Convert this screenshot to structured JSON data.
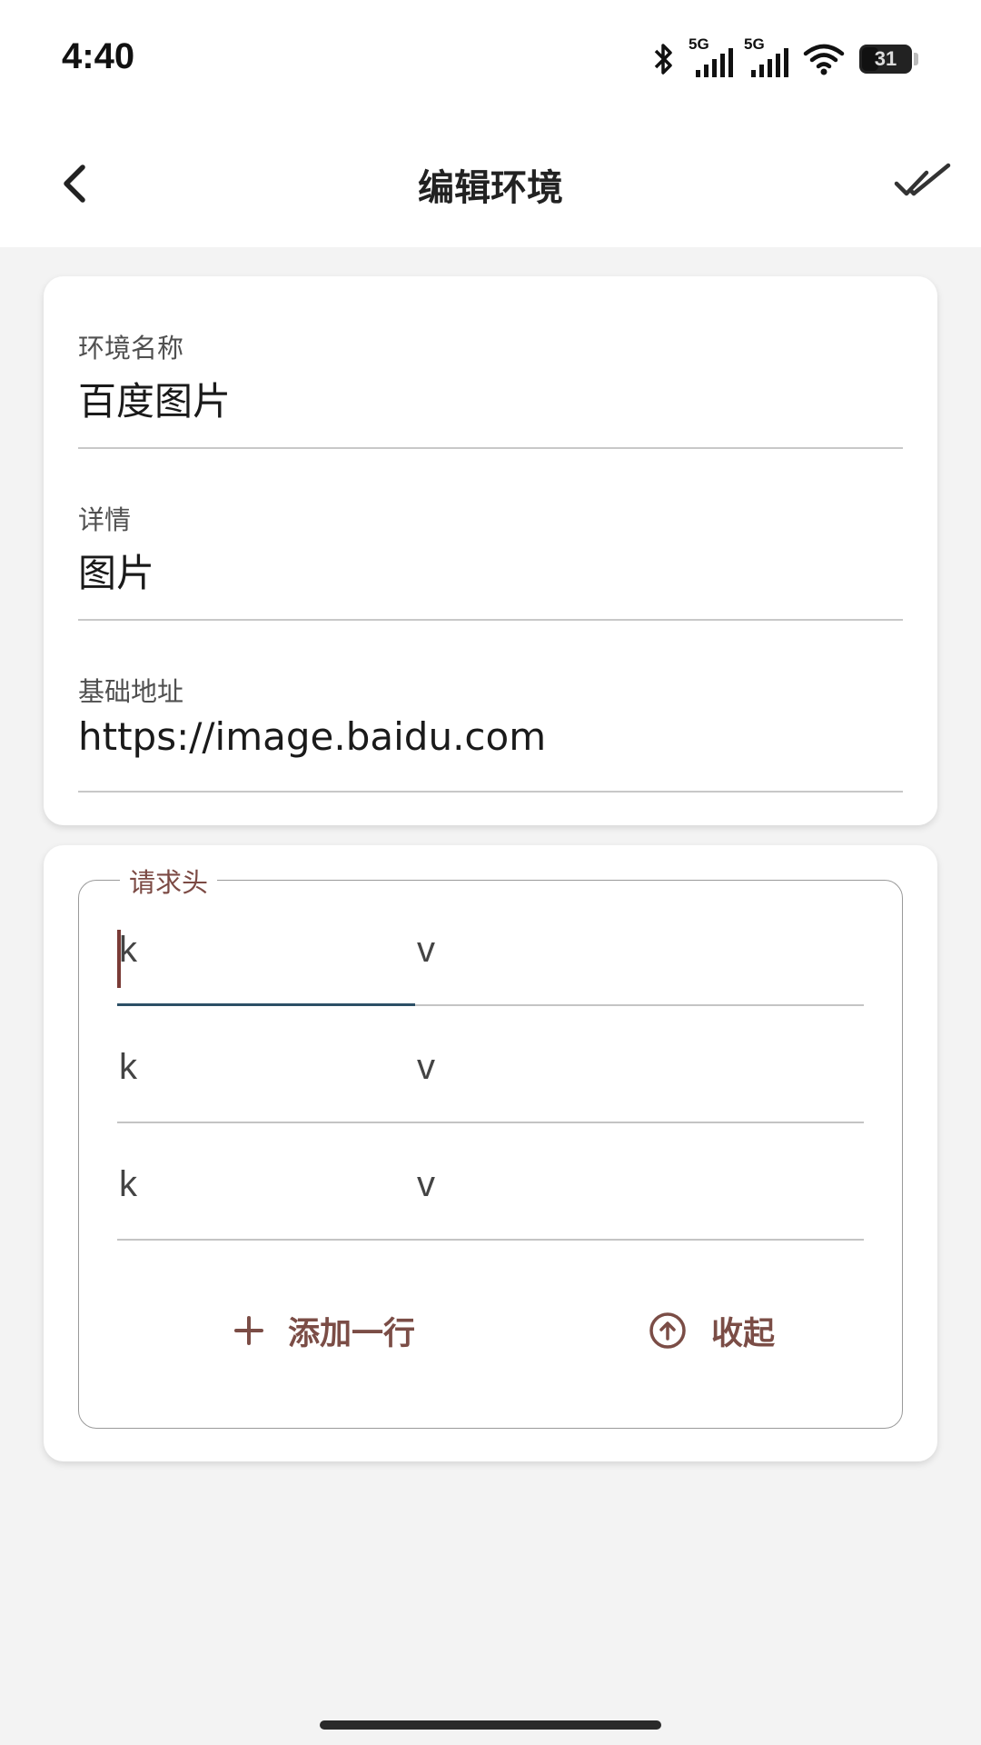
{
  "status_bar": {
    "time": "4:40",
    "network_1": "5G",
    "network_2": "5G",
    "battery_level": "31",
    "icons": [
      "bluetooth-icon",
      "signal-icon",
      "signal-icon",
      "wifi-icon",
      "battery-icon"
    ]
  },
  "app_bar": {
    "title": "编辑环境",
    "back_icon": "chevron-left-icon",
    "confirm_icon": "double-check-icon"
  },
  "environment": {
    "name_label": "环境名称",
    "name_value": "百度图片",
    "detail_label": "详情",
    "detail_value": "图片",
    "base_url_label": "基础地址",
    "base_url_value": "https://image.baidu.com"
  },
  "headers": {
    "legend": "请求头",
    "rows": [
      {
        "key_placeholder": "k",
        "value_placeholder": "v"
      },
      {
        "key_placeholder": "k",
        "value_placeholder": "v"
      },
      {
        "key_placeholder": "k",
        "value_placeholder": "v"
      }
    ],
    "add_row_label": "添加一行",
    "collapse_label": "收起"
  },
  "colors": {
    "accent": "#7b4d46",
    "focus_underline": "#2c4f66",
    "background": "#f3f3f3"
  }
}
